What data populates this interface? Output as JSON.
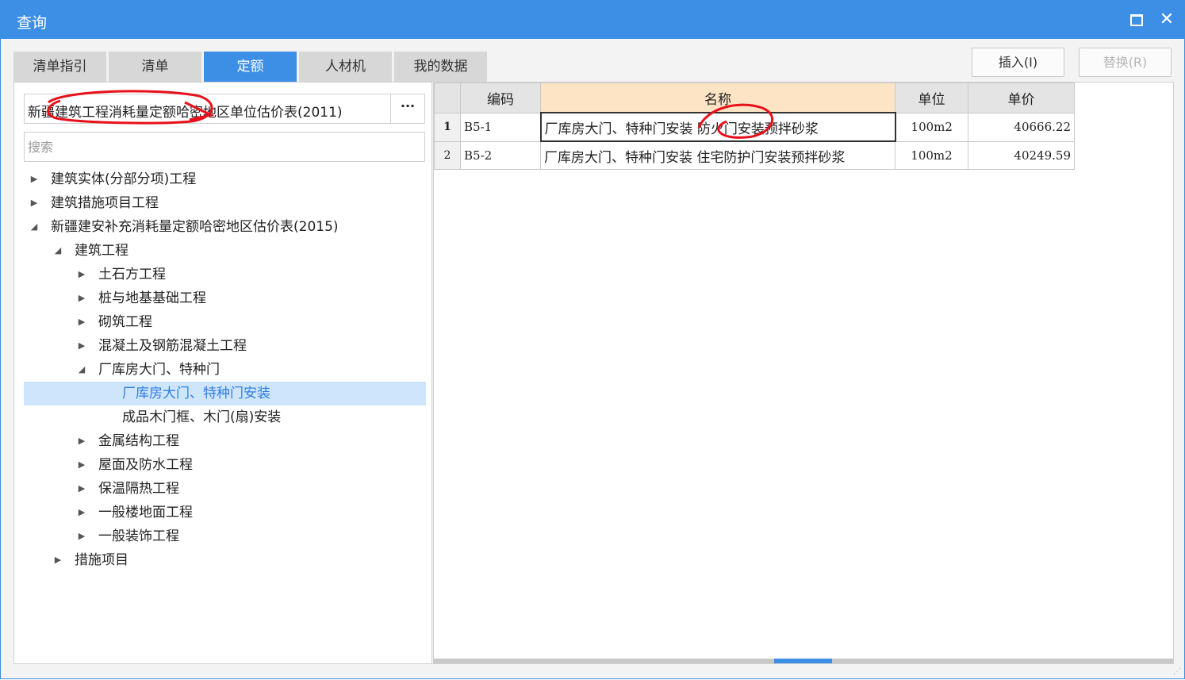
{
  "window": {
    "title": "查询"
  },
  "tabs": [
    "清单指引",
    "清单",
    "定额",
    "人材机",
    "我的数据"
  ],
  "active_tab": "定额",
  "buttons": {
    "insert": "插入(I)",
    "replace": "替换(R)"
  },
  "library": {
    "selected": "新疆建筑工程消耗量定额哈密地区单位估价表(2011)",
    "more": "···"
  },
  "search": {
    "placeholder": "搜索",
    "value": ""
  },
  "tree": [
    {
      "label": "建筑实体(分部分项)工程",
      "level": 0,
      "state": "collapsed"
    },
    {
      "label": "建筑措施项目工程",
      "level": 0,
      "state": "collapsed"
    },
    {
      "label": "新疆建安补充消耗量定额哈密地区估价表(2015)",
      "level": 0,
      "state": "expanded"
    },
    {
      "label": "建筑工程",
      "level": 1,
      "state": "expanded"
    },
    {
      "label": "土石方工程",
      "level": 2,
      "state": "collapsed"
    },
    {
      "label": "桩与地基基础工程",
      "level": 2,
      "state": "collapsed"
    },
    {
      "label": "砌筑工程",
      "level": 2,
      "state": "collapsed"
    },
    {
      "label": "混凝土及钢筋混凝土工程",
      "level": 2,
      "state": "collapsed"
    },
    {
      "label": "厂库房大门、特种门",
      "level": 2,
      "state": "expanded"
    },
    {
      "label": "厂库房大门、特种门安装",
      "level": 3,
      "state": "leaf",
      "selected": true
    },
    {
      "label": "成品木门框、木门(扇)安装",
      "level": 3,
      "state": "leaf"
    },
    {
      "label": "金属结构工程",
      "level": 2,
      "state": "collapsed"
    },
    {
      "label": "屋面及防水工程",
      "level": 2,
      "state": "collapsed"
    },
    {
      "label": "保温隔热工程",
      "level": 2,
      "state": "collapsed"
    },
    {
      "label": "一般楼地面工程",
      "level": 2,
      "state": "collapsed"
    },
    {
      "label": "一般装饰工程",
      "level": 2,
      "state": "collapsed"
    },
    {
      "label": "措施项目",
      "level": 1,
      "state": "collapsed"
    }
  ],
  "table": {
    "columns": [
      "编码",
      "名称",
      "单位",
      "单价"
    ],
    "rows": [
      {
        "no": "1",
        "code": "B5-1",
        "name": "厂库房大门、特种门安装 防火门安装预拌砂浆",
        "unit": "100m2",
        "price": "40666.22"
      },
      {
        "no": "2",
        "code": "B5-2",
        "name": "厂库房大门、特种门安装 住宅防护门安装预拌砂浆",
        "unit": "100m2",
        "price": "40249.59"
      }
    ]
  },
  "colors": {
    "accent": "#3d8fe6",
    "selected_bg": "#cfe5fb",
    "name_header": "#fde4c4",
    "annotation": "#e8101a"
  }
}
